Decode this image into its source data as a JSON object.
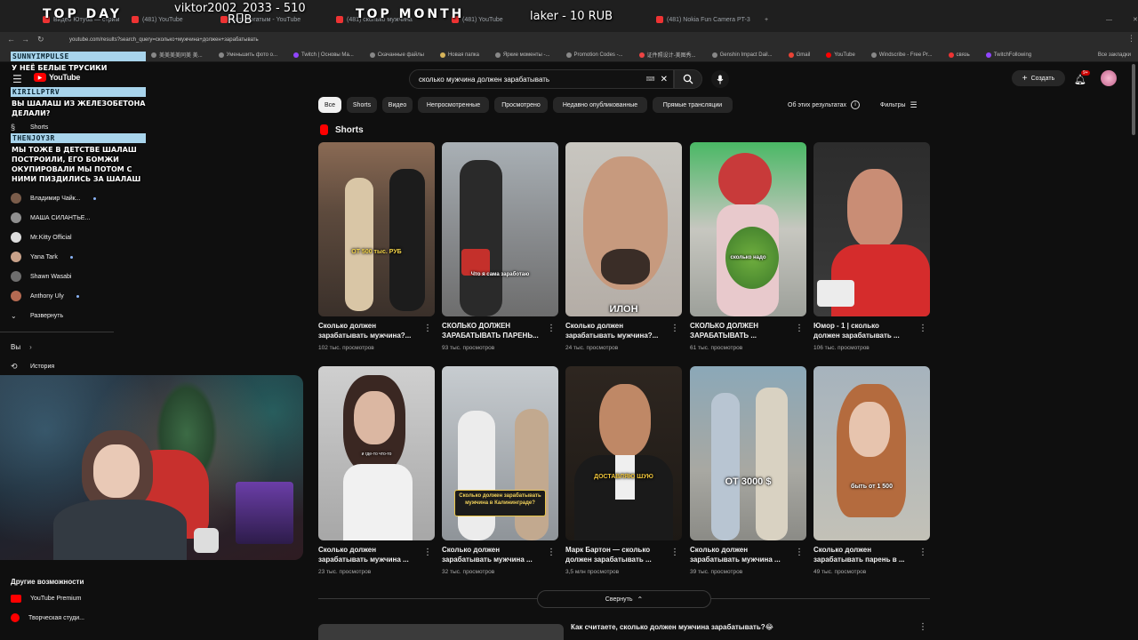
{
  "overlays": {
    "top_day": "TOP DAY",
    "top_day_user": "viktor2002_2033 - 510",
    "top_day_currency": "RUB",
    "top_month": "TOP MONTH",
    "top_month_user": "laker - 10 RUB"
  },
  "chat": [
    {
      "name": "SUNNYIMPULSE",
      "message": "У НЕЁ БЕЛЫЕ ТРУСИКИ"
    },
    {
      "name": "KIRILLPTRV",
      "message": "ВЫ ШАЛАШ ИЗ ЖЕЛЕЗОБЕТОНА ДЕЛАЛИ?"
    },
    {
      "name": "THENJOY3R",
      "message": "МЫ ТОЖЕ В ДЕТСТВЕ ШАЛАШ ПОСТРОИЛИ, ЕГО БОМЖИ ОКУПИРОВАЛИ МЫ ПОТОМ С НИМИ ПИЗДИЛИСЬ ЗА ШАЛАШ"
    }
  ],
  "browser": {
    "tabs": [
      "Видео Ютуба — стрим",
      "(481) YouTube",
      "Бить богатым - YouTube",
      "(481) сколько мужчина",
      "(481) YouTube",
      "(481) Nokia Fun Camera PT-3"
    ],
    "url": "youtube.com/results?search_query=сколько+мужчина+должен+зарабатывать",
    "bookmarks": [
      "美美美美同美 美...",
      "Уменьшить фото о...",
      "Twitch | Основы Ма...",
      "Скачанные файлы",
      "Новая папка",
      "Яркие моменты -...",
      "Promotion Codes -...",
      "证件照设计-美图秀...",
      "Genshin Impact Dail...",
      "Gmail",
      "YouTube",
      "Windscribe - Free Pr...",
      "связь",
      "TwitchFollowing",
      "Все закладки"
    ]
  },
  "youtube": {
    "logo": "YouTube",
    "search_query": "сколько мужчина должен зарабатывать",
    "create_label": "Создать",
    "notif_count": "9+",
    "chips": [
      "Все",
      "Shorts",
      "Видео",
      "Непросмотренные",
      "Просмотрено",
      "Недавно опубликованные",
      "Прямые трансляции"
    ],
    "about_results": "Об этих результатах",
    "filters": "Фильтры",
    "shorts_heading": "Shorts",
    "collapse_label": "Свернуть",
    "next_video_title": "Как считаете, сколько должен мужчина зарабатывать?😂"
  },
  "sidebar": {
    "shorts": "Shorts",
    "subscriptions": [
      {
        "name": "Владимир Чайк...",
        "dot": true
      },
      {
        "name": "МАША СИЛАНТЬЕ...",
        "dot": false
      },
      {
        "name": "Mr.Kitty Official",
        "dot": false
      },
      {
        "name": "Yana Tark",
        "dot": true
      },
      {
        "name": "Shawn Wasabi",
        "dot": false
      },
      {
        "name": "Anthony Uly",
        "dot": true
      }
    ],
    "expand": "Развернуть",
    "you": "Вы",
    "history": "История",
    "more_heading": "Другие возможности",
    "premium": "YouTube Premium",
    "studio": "Творческая студи..."
  },
  "shorts": [
    {
      "title1": "Сколько должен",
      "title2": "зарабатывать мужчина?...",
      "views": "102 тыс. просмотров",
      "caption": "ОТ 500 тыс. РУБ"
    },
    {
      "title1": "СКОЛЬКО ДОЛЖЕН",
      "title2": "ЗАРАБАТЫВАТЬ ПАРЕНЬ...",
      "views": "93 тыс. просмотров",
      "caption": "Что я сама заработаю"
    },
    {
      "title1": "Сколько должен",
      "title2": "зарабатывать мужчина?...",
      "views": "24 тыс. просмотров",
      "caption": "ИЛОН"
    },
    {
      "title1": "СКОЛЬКО ДОЛЖЕН",
      "title2": "ЗАРАБАТЫВАТЬ ...",
      "views": "61 тыс. просмотров",
      "caption": "сколько надо"
    },
    {
      "title1": "Юмор - 1 | сколько",
      "title2": "должен зарабатывать ...",
      "views": "106 тыс. просмотров",
      "caption": ""
    },
    {
      "title1": "Сколько должен",
      "title2": "зарабатывать мужчина ...",
      "views": "23 тыс. просмотров",
      "caption": "и где-то что-то"
    },
    {
      "title1": "Сколько должен",
      "title2": "зарабатывать мужчина ...",
      "views": "32 тыс. просмотров",
      "caption": "Сколько должен зарабатывать мужчина в Калининграде?"
    },
    {
      "title1": "Марк Бартон — сколько",
      "title2": "должен зарабатывать ...",
      "views": "3,5 млн просмотров",
      "caption": "ДОСТАВЛЯЮ ШУЮ"
    },
    {
      "title1": "Сколько должен",
      "title2": "зарабатывать мужчина ...",
      "views": "39 тыс. просмотров",
      "caption": "ОТ 3000 $"
    },
    {
      "title1": "Сколько должен",
      "title2": "зарабатывать парень в ...",
      "views": "49 тыс. просмотров",
      "caption": "быть от 1 500"
    }
  ],
  "colors": {
    "yt_red": "#ff0000",
    "bg": "#0f0f0f",
    "chip": "#272727",
    "chat_name_bg": "#a8d4ec"
  }
}
